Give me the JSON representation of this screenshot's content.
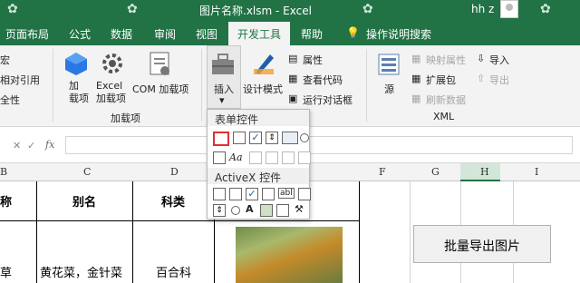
{
  "titlebar": {
    "title": "图片名称.xlsm  -  Excel",
    "user": "hh z"
  },
  "tabs": [
    "页面布局",
    "公式",
    "数据",
    "审阅",
    "视图",
    "开发工具",
    "帮助",
    "操作说明搜索"
  ],
  "ribbon": {
    "code_group": [
      "宏",
      "相对引用",
      "全性"
    ],
    "addins": {
      "addins_label": "加\n载项",
      "excel_addins_label": "Excel\n加载项",
      "com_label": "COM 加载项",
      "group_label": "加载项"
    },
    "controls": {
      "insert_label": "插入",
      "design_label": "设计模式",
      "properties": "属性",
      "view_code": "查看代码",
      "run_dialog": "运行对话框"
    },
    "xml": {
      "source": "源",
      "map_props": "映射属性",
      "expansion": "扩展包",
      "refresh": "刷新数据",
      "import": "导入",
      "export": "导出",
      "group_label": "XML"
    }
  },
  "formula_bar": {
    "fx": "fx"
  },
  "popup": {
    "form_controls": "表单控件",
    "activex_controls": "ActiveX 控件"
  },
  "columns": [
    "B",
    "C",
    "D",
    "F",
    "G",
    "H",
    "I"
  ],
  "sheet": {
    "header": {
      "col_b": "称",
      "col_c": "别名",
      "col_d": "科类"
    },
    "row1": {
      "col_b": "草",
      "col_c": "黄花菜，金针菜",
      "col_d": "百合科"
    }
  },
  "export_button": "批量导出图片"
}
